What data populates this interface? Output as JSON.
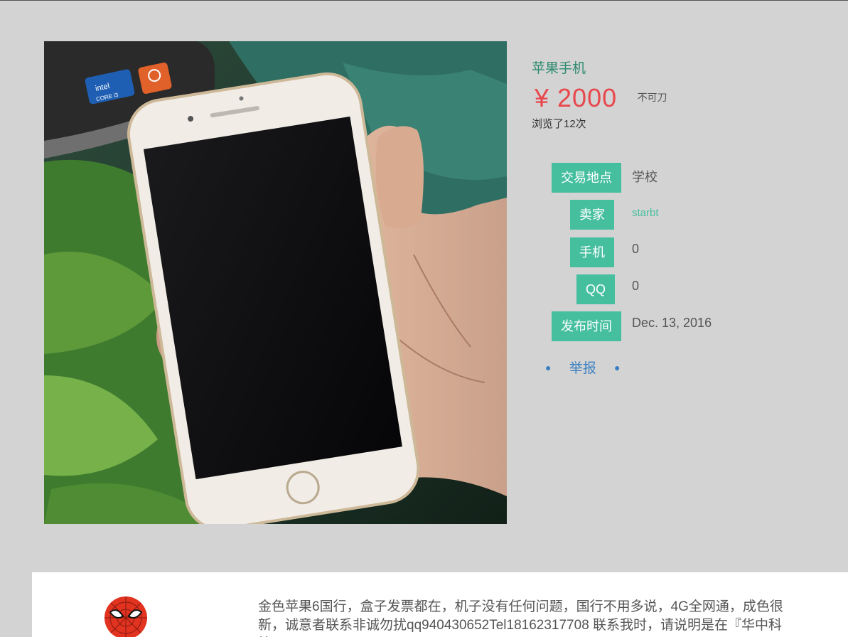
{
  "product": {
    "title": "苹果手机",
    "price": "¥ 2000",
    "negotiable": "不可刀",
    "views": "浏览了12次"
  },
  "details": [
    {
      "label": "交易地点",
      "value": "学校"
    },
    {
      "label": "卖家",
      "value": "starbt"
    },
    {
      "label": "手机",
      "value": "0"
    },
    {
      "label": "QQ",
      "value": "0"
    },
    {
      "label": "发布时间",
      "value": "Dec. 13, 2016"
    }
  ],
  "actions": {
    "report": "举报"
  },
  "description": "金色苹果6国行，盒子发票都在，机子没有任何问题，国行不用多说，4G全网通，成色很新，诚意者联系非诚勿扰qq940430652Tel18162317708 联系我时，请说明是在『华中科技",
  "photo": {
    "icon": "product-photo-iphone",
    "stickers": [
      "intel inside CORE i3",
      "ubuntu"
    ]
  },
  "colors": {
    "accent": "#46bf9f",
    "title": "#2b8a6e",
    "price": "#e8474c",
    "link": "#3a7fc2",
    "background": "#d3d3d3"
  }
}
